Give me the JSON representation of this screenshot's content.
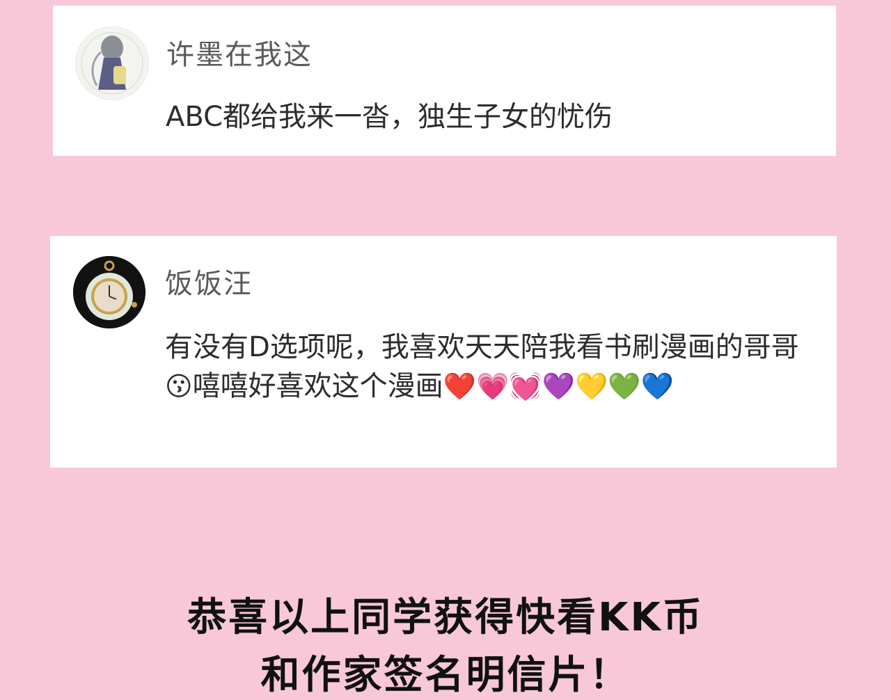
{
  "comments": [
    {
      "username": "许墨在我这",
      "text": "ABC都给我来一沓，独生子女的忧伤"
    },
    {
      "username": "饭饭汪",
      "text": "有没有D选项呢，我喜欢天天陪我看书刷漫画的哥哥",
      "emoji_kiss": "😗",
      "text_after": "嘻嘻好喜欢这个漫画",
      "hearts": [
        "❤️",
        "💗",
        "💓",
        "💜",
        "💛",
        "💚",
        "💙"
      ]
    }
  ],
  "footer": {
    "line1": "恭喜以上同学获得快看KK币",
    "line2": "和作家签名明信片！"
  },
  "colors": {
    "background": "#f8c8d8",
    "card": "#ffffff",
    "username": "#5a5a5a",
    "comment_text": "#2c2c2c",
    "footer_text": "#111111"
  }
}
